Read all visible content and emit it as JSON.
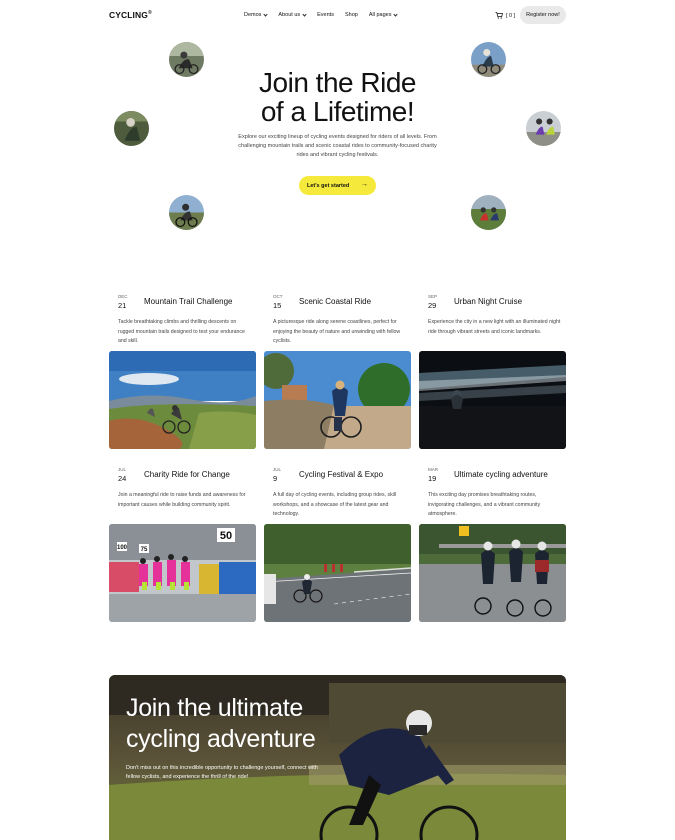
{
  "nav": {
    "logo": "CYCLING",
    "logo_mark": "®",
    "menu": [
      {
        "label": "Demos",
        "has_dropdown": true
      },
      {
        "label": "About us",
        "has_dropdown": true
      },
      {
        "label": "Events",
        "has_dropdown": false
      },
      {
        "label": "Shop",
        "has_dropdown": false
      },
      {
        "label": "All pages",
        "has_dropdown": true
      }
    ],
    "cart_count": "[ 0 ]",
    "register_label": "Register now!"
  },
  "hero": {
    "title_line1": "Join the Ride",
    "title_line2": "of a Lifetime!",
    "description": "Explore our exciting lineup of cycling events designed for riders of all levels. From challenging mountain trails and scenic coastal rides to community-focused charity rides and vibrant cycling festivals.",
    "cta_label": "Let's get started",
    "cta_icon": "arrow-right-icon"
  },
  "events": [
    {
      "month": "DEC",
      "day": "21",
      "title": "Mountain Trail Challenge",
      "description": "Tackle breathtaking climbs and thrilling descents on rugged mountain trails designed to test your endurance and skill."
    },
    {
      "month": "OCT",
      "day": "15",
      "title": "Scenic Coastal Ride",
      "description": "A picturesque ride along serene coastlines, perfect for enjoying the beauty of nature and unwinding with fellow cyclists."
    },
    {
      "month": "SEP",
      "day": "29",
      "title": "Urban Night Cruise",
      "description": "Experience the city in a new light with an illuminated night ride through vibrant streets and iconic landmarks."
    },
    {
      "month": "JUL",
      "day": "24",
      "title": "Charity Ride for Change",
      "description": "Join a meaningful ride to raise funds and awareness for important causes while building community spirit."
    },
    {
      "month": "JUL",
      "day": "9",
      "title": "Cycling Festival & Expo",
      "description": "A full day of cycling events, including group rides, skill workshops, and a showcase of the latest gear and technology."
    },
    {
      "month": "MAR",
      "day": "19",
      "title": "Ultimate cycling adventure",
      "description": "This exciting day promises breathtaking routes, invigorating challenges, and a vibrant community atmosphere."
    }
  ],
  "charity_bibs": [
    "50",
    "75",
    "100"
  ],
  "banner": {
    "title_line1": "Join the ultimate",
    "title_line2": "cycling adventure",
    "description": "Don't miss out on this incredible opportunity to challenge yourself, connect with fellow cyclists, and experience the thrill of the ride!"
  },
  "colors": {
    "accent": "#f5ea3c",
    "button_gray": "#e9e9ea",
    "text": "#111111",
    "muted": "#444444"
  }
}
